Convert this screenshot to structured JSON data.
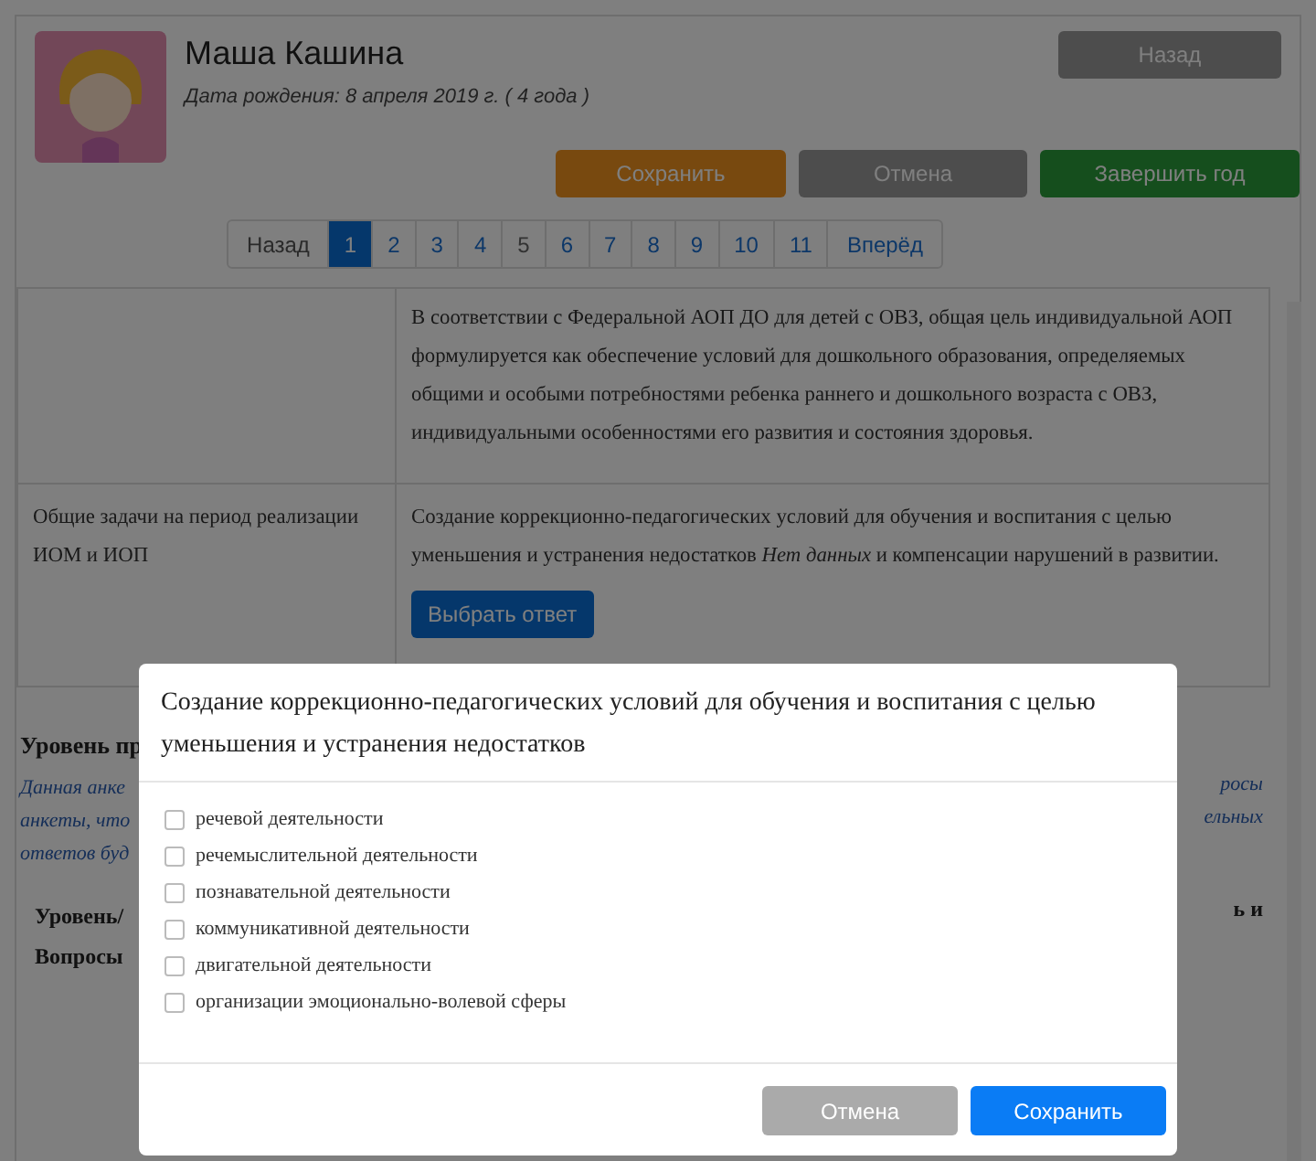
{
  "profile": {
    "name": "Маша Кашина",
    "birth_date": "Дата рождения: 8 апреля 2019 г. ( 4 года )"
  },
  "back_button": "Назад",
  "actions": [
    {
      "label": "Сохранить",
      "kind": "save"
    },
    {
      "label": "Отмена",
      "kind": "cancel"
    },
    {
      "label": "Завершить год",
      "kind": "finish"
    }
  ],
  "pagination": {
    "prev": "Назад",
    "next": "Вперёд",
    "pages": [
      {
        "label": "1",
        "selected": true,
        "disabled": false
      },
      {
        "label": "2",
        "selected": false,
        "disabled": false
      },
      {
        "label": "3",
        "selected": false,
        "disabled": false
      },
      {
        "label": "4",
        "selected": false,
        "disabled": false
      },
      {
        "label": "5",
        "selected": false,
        "disabled": true
      },
      {
        "label": "6",
        "selected": false,
        "disabled": false
      },
      {
        "label": "7",
        "selected": false,
        "disabled": false
      },
      {
        "label": "8",
        "selected": false,
        "disabled": false
      },
      {
        "label": "9",
        "selected": false,
        "disabled": false
      },
      {
        "label": "10",
        "selected": false,
        "disabled": false
      },
      {
        "label": "11",
        "selected": false,
        "disabled": false
      }
    ]
  },
  "goal_text": "В соответствии с Федеральной АОП ДО для детей с ОВЗ, общая цель индивидуальной АОП формулируется как обеспечение условий для дошкольного образования, определяемых общими и особыми потребностями ребенка раннего и дошкольного возраста с ОВЗ, индивидуальными особенностями его развития и состояния здоровья.",
  "tasks_row": {
    "label": "Общие задачи на период реализации ИОМ и ИОП",
    "text": "Создание коррекционно-педагогических условий для обучения и воспитания с целью уменьшения и устранения недостатков *Нет данных* и компенсации нарушений в развитии.",
    "button": "Выбрать ответ"
  },
  "behind_modal": {
    "heading": "Уровень пр",
    "note_left": [
      "Данная анке",
      "анкеты, что",
      "ответов буд"
    ],
    "note_right": [
      "росы",
      "ельных"
    ],
    "table_header_left": "Уровень/ Вопросы",
    "table_header_right": "ь и"
  },
  "modal": {
    "title": "Создание коррекционно-педагогических условий для обучения и воспитания с целью уменьшения и устранения недостатков",
    "options": [
      {
        "label": "речевой деятельности",
        "checked": false
      },
      {
        "label": "речемыслительной деятельности",
        "checked": false
      },
      {
        "label": "познавательной деятельности",
        "checked": false
      },
      {
        "label": "коммуникативной деятельности",
        "checked": false
      },
      {
        "label": "двигательной деятельности",
        "checked": false
      },
      {
        "label": "организации эмоционально-волевой сферы",
        "checked": false
      }
    ],
    "cancel": "Отмена",
    "save": "Сохранить"
  }
}
